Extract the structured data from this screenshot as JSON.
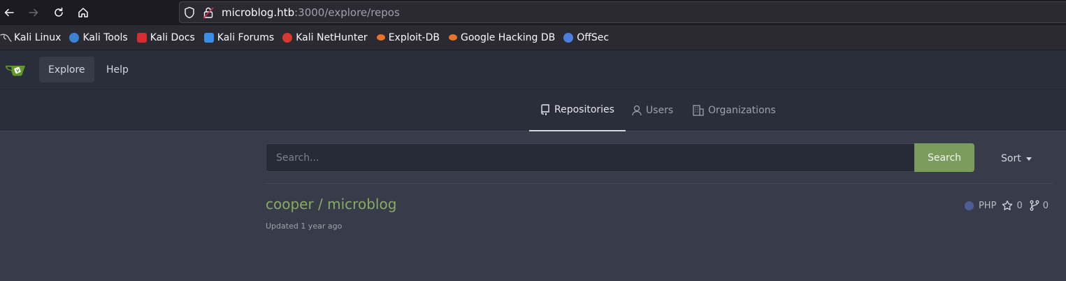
{
  "browser": {
    "url_host": "microblog.htb",
    "url_rest": ":3000/explore/repos",
    "bookmarks": [
      {
        "label": "Kali Linux",
        "icon": "kali-dragon-icon",
        "color": "#cfcfd6"
      },
      {
        "label": "Kali Tools",
        "icon": "kali-tools-icon",
        "color": "#3b82d6"
      },
      {
        "label": "Kali Docs",
        "icon": "kali-docs-icon",
        "color": "#d62e2e"
      },
      {
        "label": "Kali Forums",
        "icon": "kali-forums-icon",
        "color": "#3a8ee6"
      },
      {
        "label": "Kali NetHunter",
        "icon": "kali-nethunter-icon",
        "color": "#d63a2e"
      },
      {
        "label": "Exploit-DB",
        "icon": "exploit-db-icon",
        "color": "#e8732b"
      },
      {
        "label": "Google Hacking DB",
        "icon": "ghdb-icon",
        "color": "#e8732b"
      },
      {
        "label": "OffSec",
        "icon": "offsec-icon",
        "color": "#4a7fe0"
      }
    ]
  },
  "navbar": {
    "items": [
      "Explore",
      "Help"
    ]
  },
  "tabs": {
    "repositories": "Repositories",
    "users": "Users",
    "organizations": "Organizations"
  },
  "search": {
    "placeholder": "Search...",
    "button": "Search",
    "sort": "Sort"
  },
  "repo": {
    "name": "cooper / microblog",
    "updated": "Updated 1 year ago",
    "language": "PHP",
    "language_color": "#4f5d95",
    "stars": "0",
    "forks": "0"
  },
  "colors": {
    "accent": "#87ab63",
    "search_button": "#7b9c5d",
    "background": "#383c4a"
  }
}
